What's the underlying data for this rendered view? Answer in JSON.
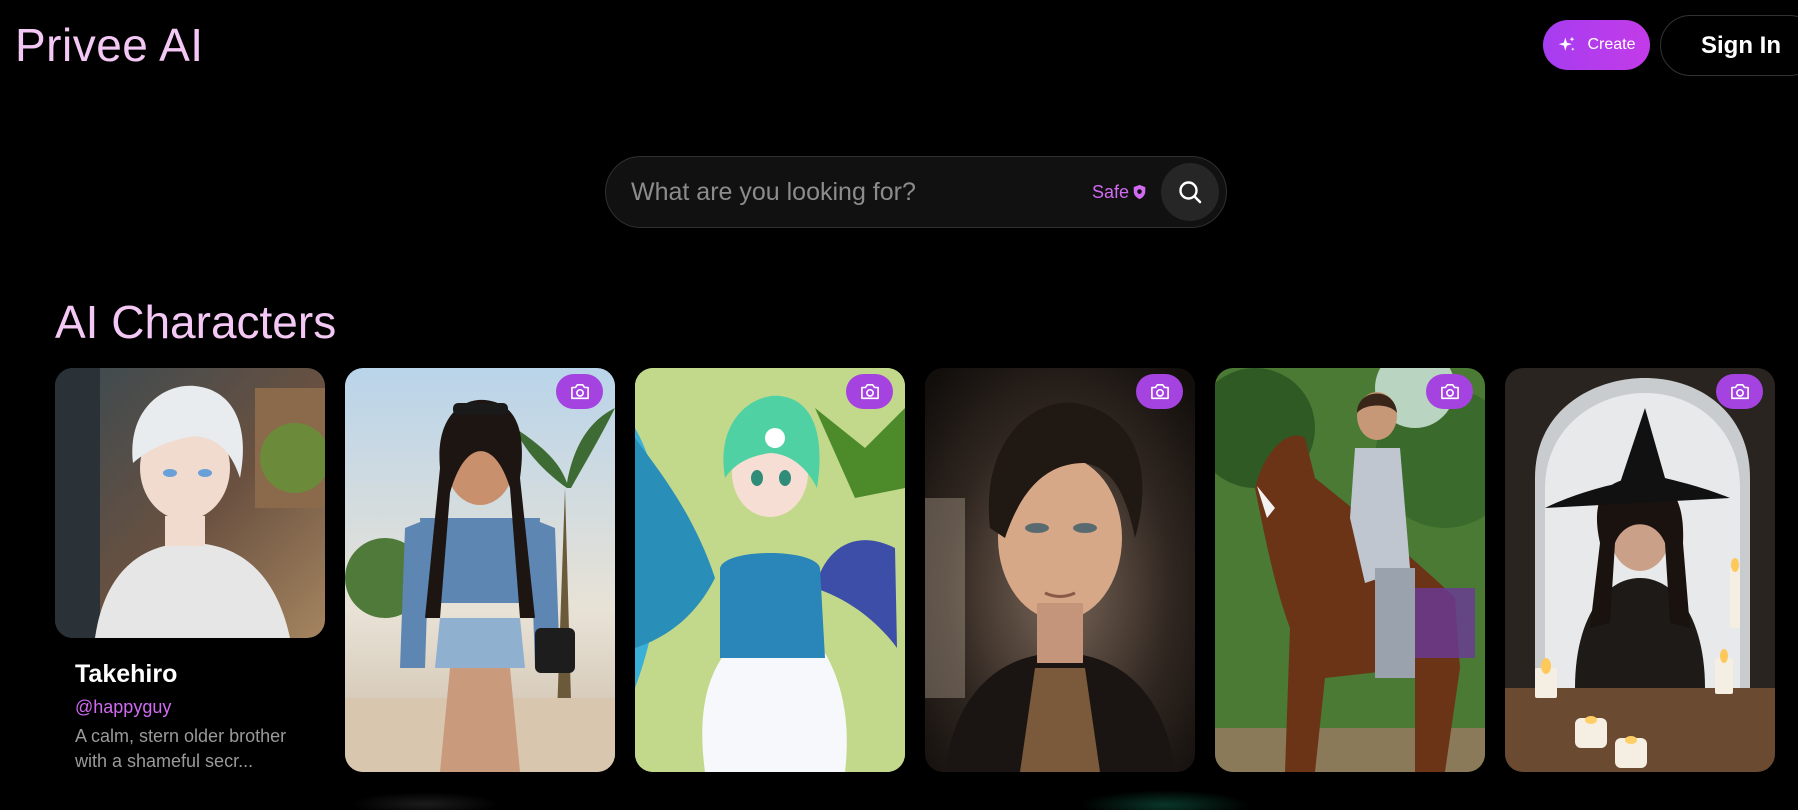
{
  "brand": {
    "logo": "Privee AI"
  },
  "header": {
    "create_label": "Create",
    "signin_label": "Sign In"
  },
  "search": {
    "placeholder": "What are you looking for?",
    "safe_label": "Safe"
  },
  "section": {
    "title": "AI Characters"
  },
  "featured": {
    "name": "Takehiro",
    "handle": "@happyguy",
    "description": "A calm, stern older brother with a shameful secr..."
  },
  "colors": {
    "accent": "#c33be8",
    "title_pink": "#f3c8f5",
    "handle_purple": "#d06bf2"
  },
  "cards": [
    {
      "subject": "woman in denim at a palm-lined street"
    },
    {
      "subject": "anime fairy with butterfly wings"
    },
    {
      "subject": "dark-haired man portrait"
    },
    {
      "subject": "knight in armor on a horse"
    },
    {
      "subject": "witch with candles in stone archway"
    }
  ]
}
